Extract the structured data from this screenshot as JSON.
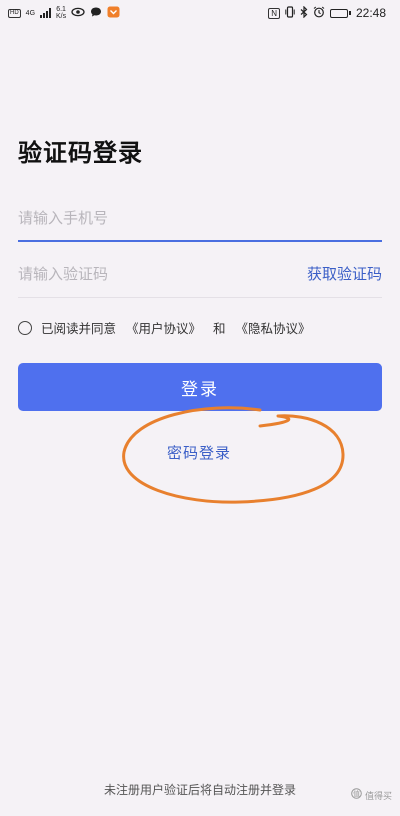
{
  "status_bar": {
    "carrier_label": "HD",
    "network": "4G",
    "speed_value": "6.1",
    "speed_unit": "K/s",
    "time": "22:48",
    "nfc": "N",
    "battery_level": 0.85
  },
  "page": {
    "title": "验证码登录"
  },
  "form": {
    "phone_placeholder": "请输入手机号",
    "code_placeholder": "请输入验证码",
    "get_code_label": "获取验证码"
  },
  "agreement": {
    "prefix": "已阅读并同意",
    "user_agreement": "《用户协议》",
    "and": "和",
    "privacy_policy": "《隐私协议》"
  },
  "buttons": {
    "login": "登录",
    "password_login": "密码登录"
  },
  "footer": {
    "note": "未注册用户验证后将自动注册并登录"
  },
  "watermark": {
    "text": "值得买"
  },
  "colors": {
    "accent": "#4f70ee",
    "link": "#3b5fc7",
    "annotation": "#e8802e"
  }
}
